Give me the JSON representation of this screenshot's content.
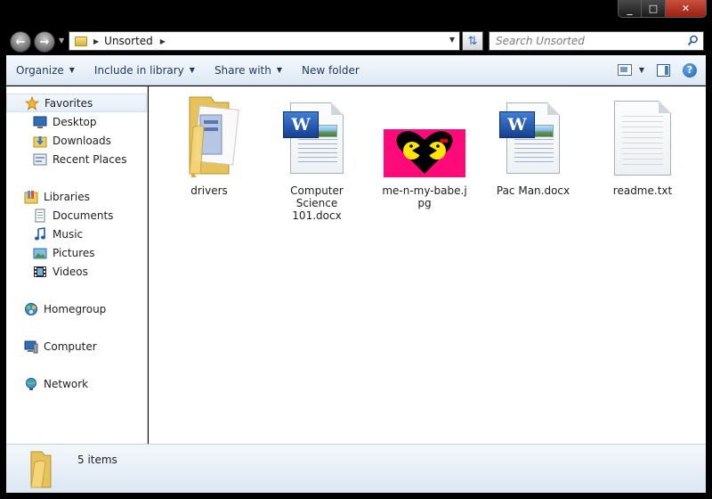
{
  "window": {
    "caption_buttons": {
      "minimize": "_",
      "maximize": "□",
      "close": "✕"
    }
  },
  "address": {
    "crumb": "Unsorted",
    "search_placeholder": "Search Unsorted"
  },
  "toolbar": {
    "organize": "Organize",
    "include_in_library": "Include in library",
    "share_with": "Share with",
    "new_folder": "New folder",
    "help": "?"
  },
  "nav": {
    "favorites": "Favorites",
    "desktop": "Desktop",
    "downloads": "Downloads",
    "recent_places": "Recent Places",
    "libraries": "Libraries",
    "documents": "Documents",
    "music": "Music",
    "pictures": "Pictures",
    "videos": "Videos",
    "homegroup": "Homegroup",
    "computer": "Computer",
    "network": "Network"
  },
  "files": [
    {
      "name": "drivers",
      "icon": "folder-icon"
    },
    {
      "name": "Computer Science 101.docx",
      "icon": "word-doc-icon"
    },
    {
      "name": "me-n-my-babe.jpg",
      "icon": "image-thumbnail"
    },
    {
      "name": "Pac Man.docx",
      "icon": "word-doc-icon"
    },
    {
      "name": "readme.txt",
      "icon": "text-file-icon"
    }
  ],
  "file_labels": {
    "f0": "drivers",
    "f1a": "Computer",
    "f1b": "Science 101.docx",
    "f2a": "me-n-my-babe.j",
    "f2b": "pg",
    "f3": "Pac Man.docx",
    "f4": "readme.txt"
  },
  "details": {
    "count": "5 items"
  },
  "colors": {
    "frame": "#000000",
    "command_bar": "#dde8f3",
    "image_bg": "#ff0a78",
    "heart": "#000000",
    "pacman": "#ffe600"
  }
}
